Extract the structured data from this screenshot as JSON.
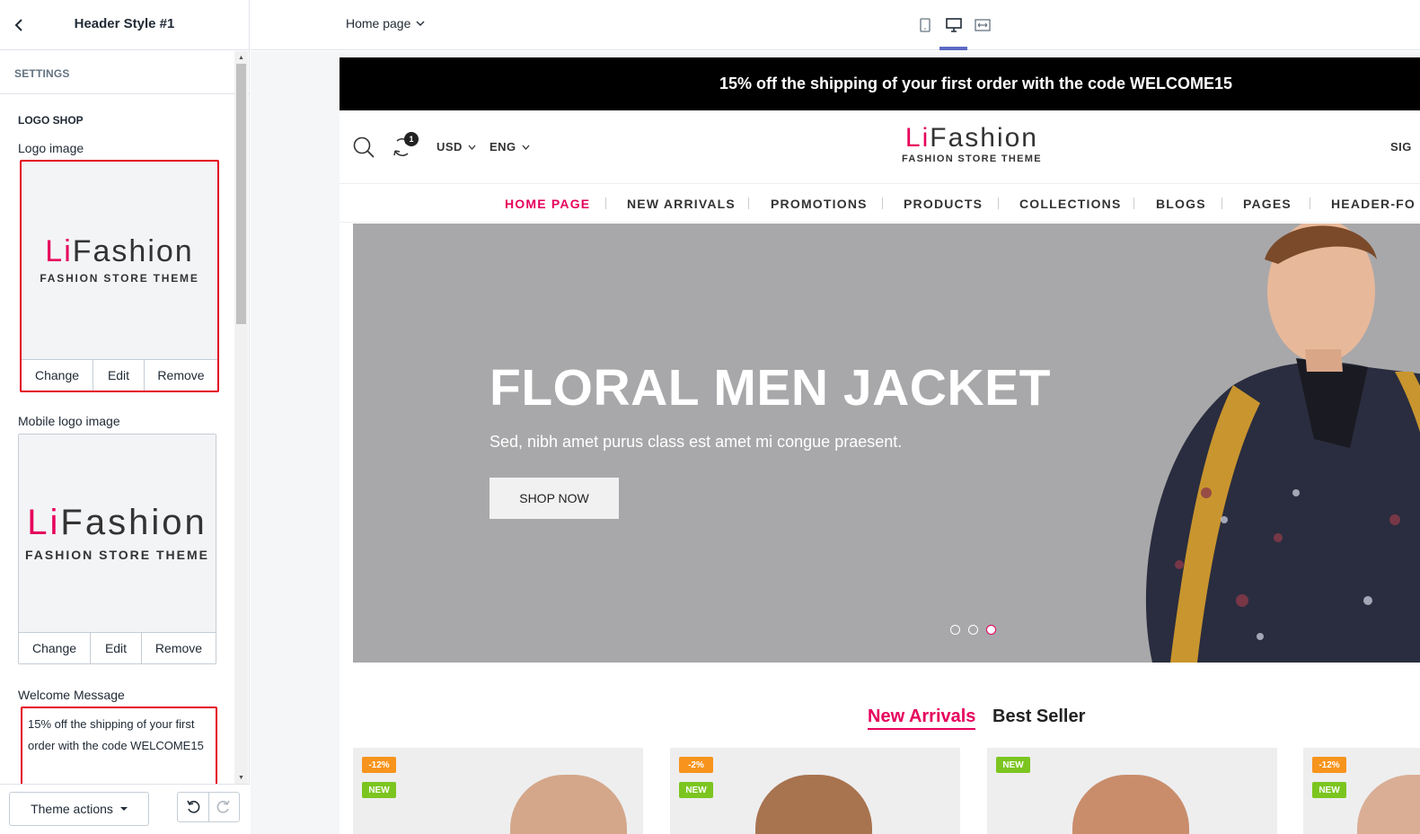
{
  "sidebar": {
    "title": "Header Style #1",
    "section": "SETTINGS",
    "group": "LOGO SHOP",
    "logo_image_label": "Logo image",
    "mobile_logo_label": "Mobile logo image",
    "welcome_label": "Welcome Message",
    "welcome_value": "15% off the shipping of your first order with the code WELCOME15",
    "actions": {
      "change": "Change",
      "edit": "Edit",
      "remove": "Remove"
    },
    "theme_actions": "Theme actions"
  },
  "logo": {
    "accent": "Li",
    "rest": "Fashion",
    "tagline": "FASHION STORE THEME"
  },
  "topbar": {
    "page": "Home page"
  },
  "site": {
    "announcement": "15% off the shipping of your first order with the code WELCOME15",
    "compare_count": "1",
    "currency": "USD",
    "language": "ENG",
    "sign_in": "SIG",
    "nav": [
      "HOME PAGE",
      "NEW ARRIVALS",
      "PROMOTIONS",
      "PRODUCTS",
      "COLLECTIONS",
      "BLOGS",
      "PAGES",
      "HEADER-FO"
    ],
    "hero": {
      "title": "FLORAL MEN JACKET",
      "subtitle": "Sed, nibh amet purus class est amet mi congue praesent.",
      "button": "SHOP NOW",
      "active_slide": 3
    },
    "tabs": [
      "New Arrivals",
      "Best Seller"
    ],
    "products": [
      {
        "sale": "-12%",
        "new": "NEW"
      },
      {
        "sale": "-2%",
        "new": "NEW"
      },
      {
        "sale": "",
        "new": "NEW"
      },
      {
        "sale": "-12%",
        "new": "NEW"
      }
    ]
  },
  "colors": {
    "accent": "#e6005c",
    "highlight": "#e3001b",
    "hero_bg": "#a8a8aa",
    "sale_tag": "#f7941d",
    "new_tag": "#7cc520"
  }
}
